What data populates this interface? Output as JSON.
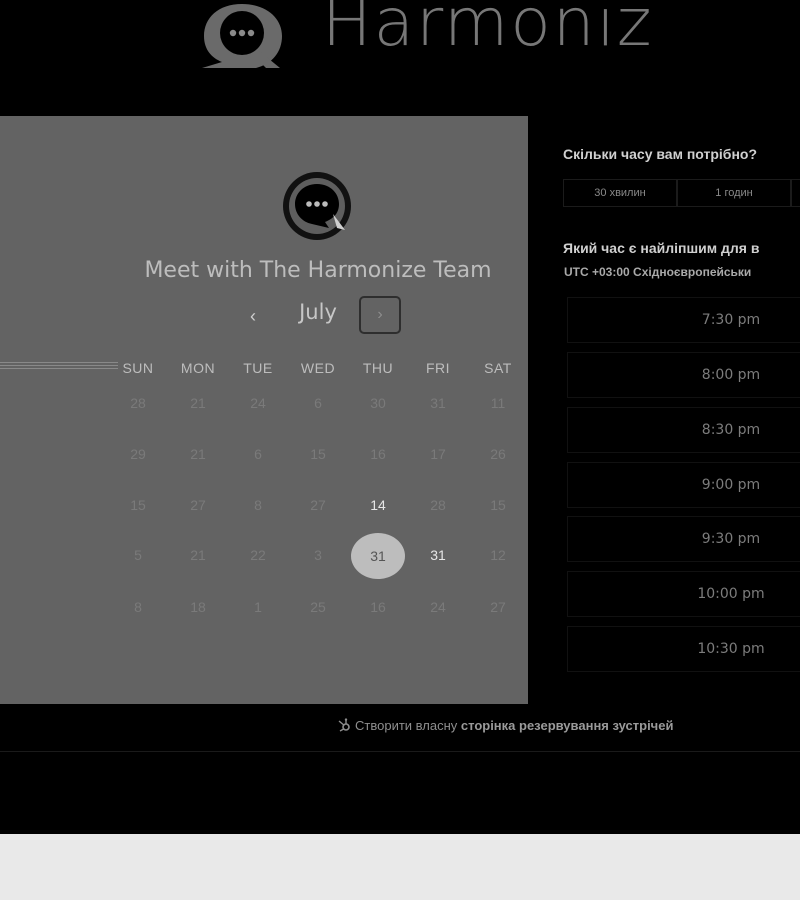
{
  "brand": {
    "name": "Harmoniz",
    "logo_icon": "chat-bubble-icon"
  },
  "calendar": {
    "title": "Meet with The Harmonize Team",
    "month": "July",
    "prev_icon": "‹",
    "next_icon": "›",
    "weekdays": [
      "SUN",
      "MON",
      "TUE",
      "WED",
      "THU",
      "FRI",
      "SAT"
    ],
    "weeks": [
      [
        "28",
        "21",
        "24",
        "6",
        "30",
        "31",
        "11"
      ],
      [
        "29",
        "21",
        "6",
        "15",
        "16",
        "17",
        "26"
      ],
      [
        "15",
        "27",
        "8",
        "27",
        "14",
        "28",
        "15"
      ],
      [
        "5",
        "21",
        "22",
        "3",
        "31",
        "31",
        "12"
      ],
      [
        "8",
        "18",
        "1",
        "25",
        "16",
        "24",
        "27"
      ]
    ],
    "available": [
      "2-4",
      "3-5"
    ],
    "selected": "3-4"
  },
  "booking": {
    "duration_question": "Скільки часу вам потрібно?",
    "durations": [
      "30 хвилин",
      "1 годин",
      ""
    ],
    "time_question": "Який час є найліпшим для в",
    "timezone_offset": "UTC +03:00",
    "timezone_name": "Східноєвропейськи",
    "slots": [
      "7:30 pm",
      "8:00 pm",
      "8:30 pm",
      "9:00 pm",
      "9:30 pm",
      "10:00 pm",
      "10:30 pm"
    ]
  },
  "footer": {
    "prefix": "Створити власну",
    "link": "сторінка резервування зустрічей",
    "icon": "hubspot-sprocket-icon"
  }
}
